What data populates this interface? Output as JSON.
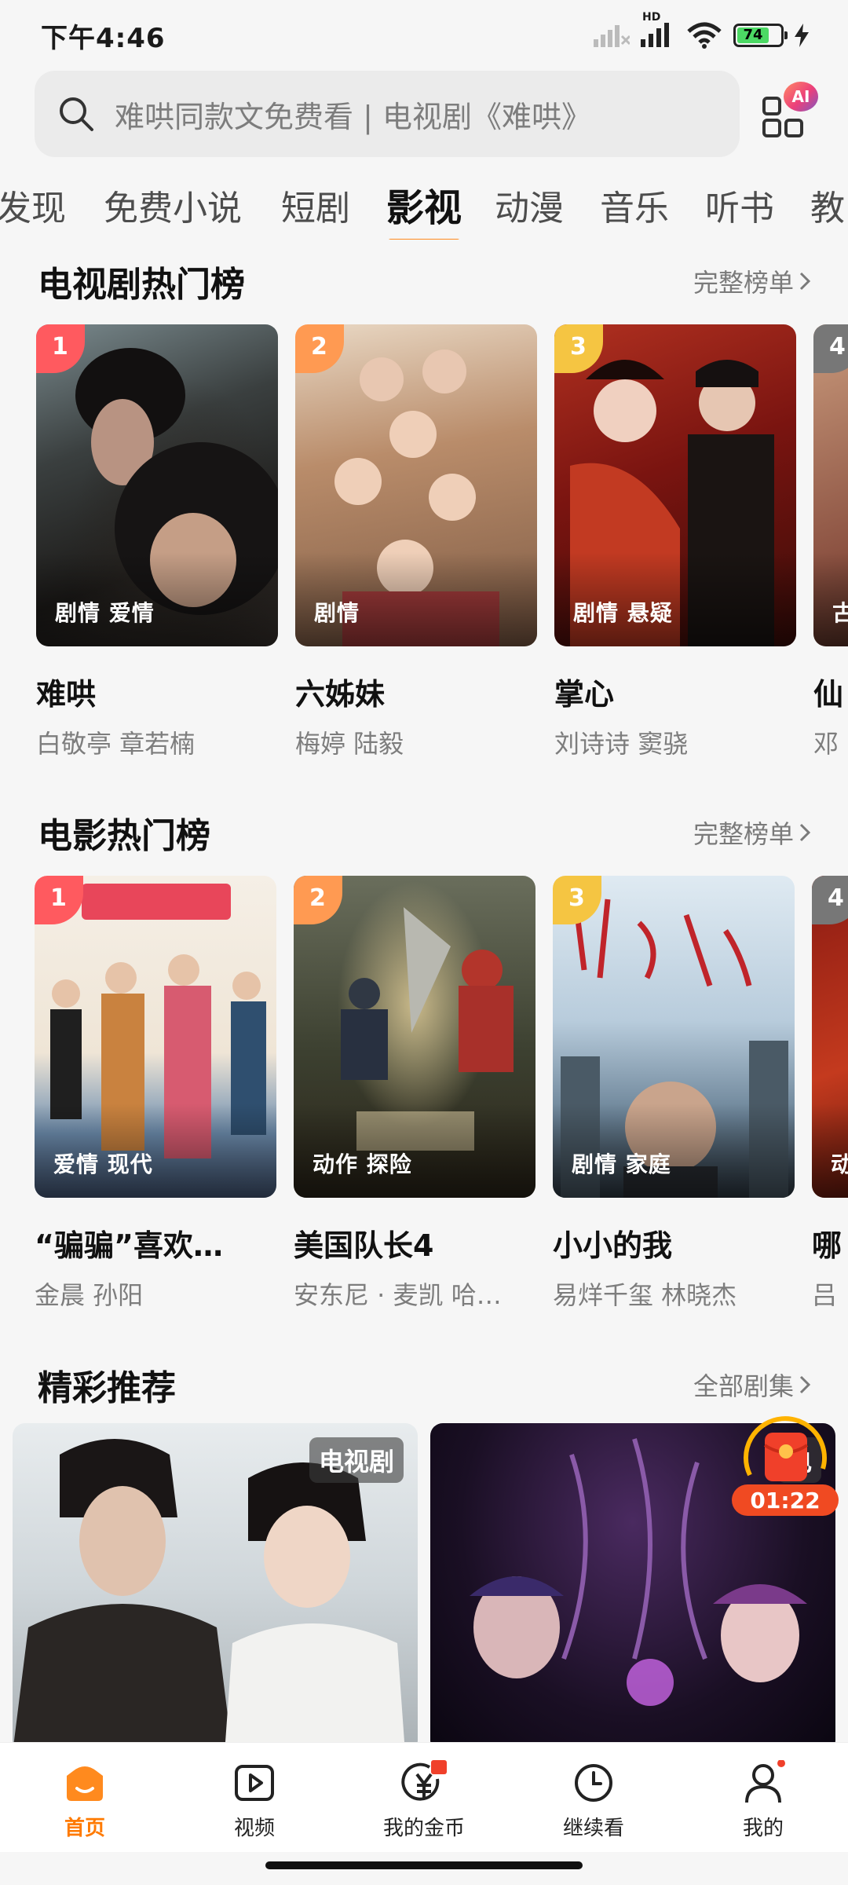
{
  "status_bar": {
    "time": "下午4:46",
    "signal_label": "HD",
    "battery": "74"
  },
  "search": {
    "placeholder": "难哄同款文免费看 | 电视剧《难哄》",
    "ai_badge": "AI"
  },
  "tabs": [
    "发现",
    "免费小说",
    "短剧",
    "影视",
    "动漫",
    "音乐",
    "听书",
    "教"
  ],
  "active_tab": "影视",
  "tv_section": {
    "title": "电视剧热门榜",
    "more": "完整榜单",
    "items": [
      {
        "rank": "1",
        "tags": "剧情 爱情",
        "title": "难哄",
        "cast": "白敬亭 章若楠"
      },
      {
        "rank": "2",
        "tags": "剧情",
        "title": "六姊妹",
        "cast": "梅婷 陆毅"
      },
      {
        "rank": "3",
        "tags": "剧情 悬疑",
        "title": "掌心",
        "cast": "刘诗诗 窦骁"
      },
      {
        "rank": "4",
        "tags": "古",
        "title": "仙",
        "cast": "邓"
      }
    ]
  },
  "movie_section": {
    "title": "电影热门榜",
    "more": "完整榜单",
    "items": [
      {
        "rank": "1",
        "tags": "爱情 现代",
        "title": "“骗骗”喜欢…",
        "cast": "金晨 孙阳"
      },
      {
        "rank": "2",
        "tags": "动作 探险",
        "title": "美国队长4",
        "cast": "安东尼 · 麦凯 哈…"
      },
      {
        "rank": "3",
        "tags": "剧情 家庭",
        "title": "小小的我",
        "cast": "易烊千玺 林晓杰"
      },
      {
        "rank": "4",
        "tags": "动",
        "title": "哪",
        "cast": "吕"
      }
    ]
  },
  "rec_section": {
    "title": "精彩推荐",
    "more": "全部剧集",
    "items": [
      {
        "label": "电视剧"
      },
      {
        "label": "电"
      }
    ]
  },
  "red_packet": {
    "timer": "01:22"
  },
  "bottom_nav": [
    {
      "label": "首页",
      "icon": "home-icon"
    },
    {
      "label": "视频",
      "icon": "video-play-icon"
    },
    {
      "label": "我的金币",
      "icon": "coin-icon"
    },
    {
      "label": "继续看",
      "icon": "clock-icon"
    },
    {
      "label": "我的",
      "icon": "profile-icon"
    }
  ],
  "colors": {
    "accent": "#ff8a1e",
    "rank1": "#ff5a5f",
    "rank2": "#ff9a52",
    "rank3": "#f5c542",
    "rank4": "#777777"
  }
}
